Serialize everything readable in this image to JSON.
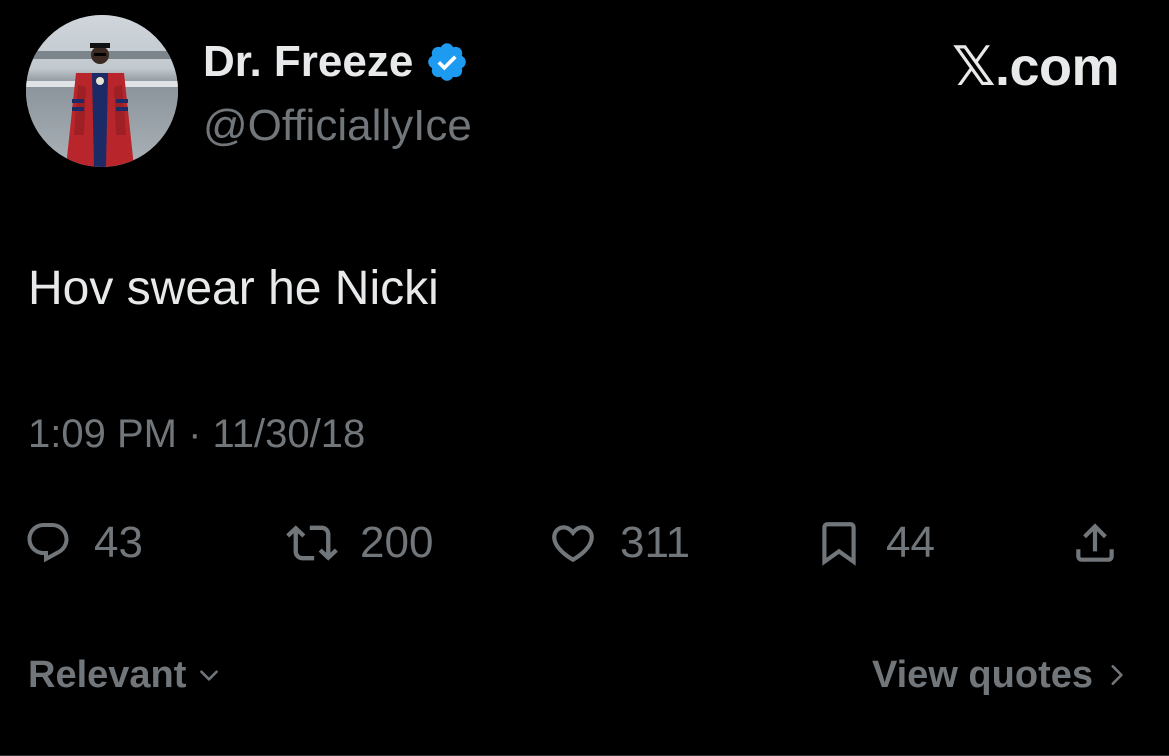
{
  "author": {
    "display_name": "Dr. Freeze",
    "handle": "@OfficiallyIce",
    "verified": true,
    "avatar_icon": "profile-photo"
  },
  "brand": "𝕏.com",
  "tweet": {
    "text": "Hov swear he Nicki",
    "time": "1:09 PM",
    "separator": "·",
    "date": "11/30/18",
    "time_date": "1:09 PM · 11/30/18"
  },
  "actions": {
    "replies": "43",
    "reposts": "200",
    "likes": "311",
    "bookmarks": "44"
  },
  "footer": {
    "sort_label": "Relevant",
    "quotes_label": "View quotes"
  },
  "colors": {
    "background": "#000000",
    "primary_text": "#e7e9ea",
    "secondary_text": "#71767b",
    "verified_blue": "#1d9bf0"
  },
  "icons": {
    "reply": "reply-icon",
    "repost": "repost-icon",
    "like": "heart-icon",
    "bookmark": "bookmark-icon",
    "share": "share-icon",
    "verified": "verified-badge-icon"
  }
}
